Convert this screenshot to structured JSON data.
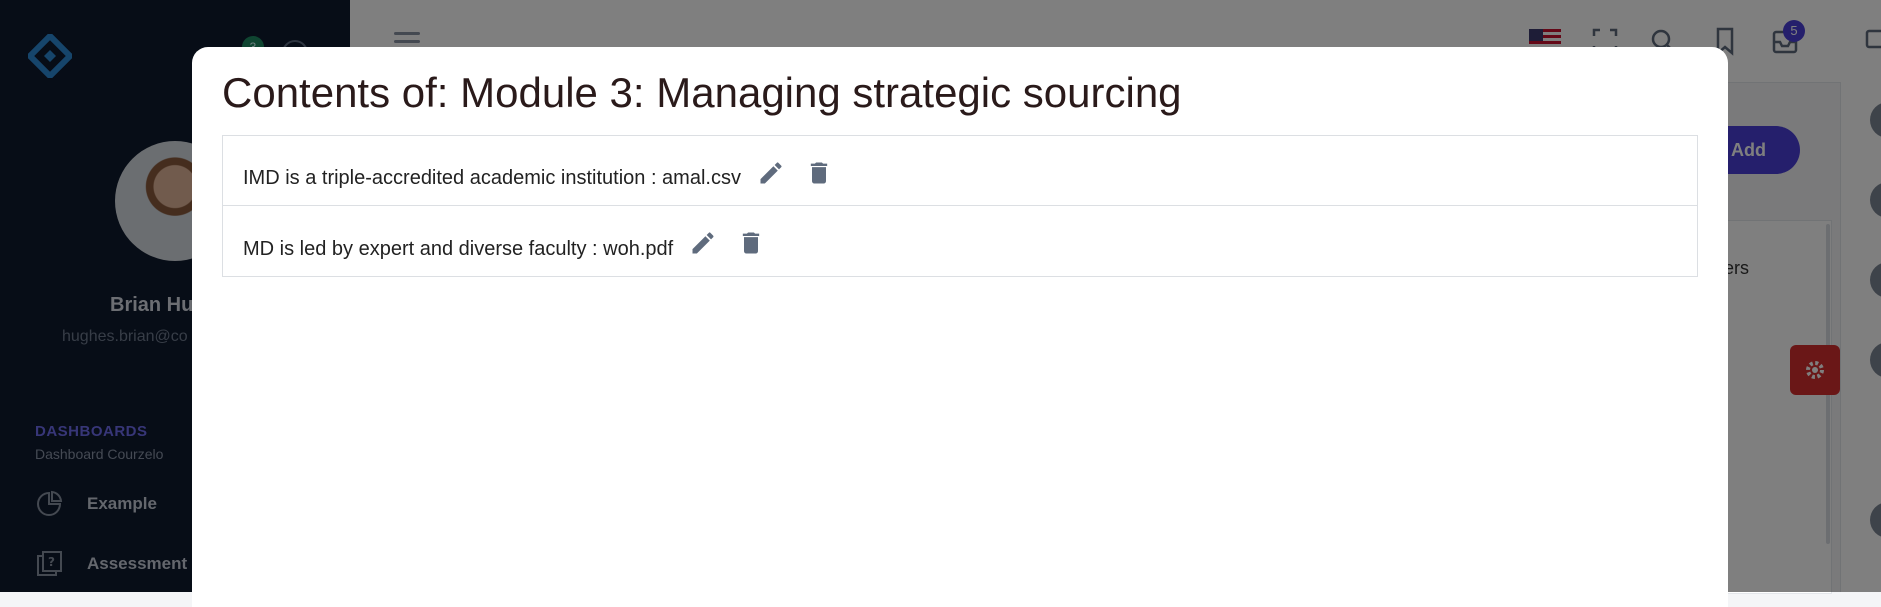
{
  "sidebar": {
    "notification_count": "3",
    "user": {
      "name": "Brian Hu",
      "email": "hughes.brian@co"
    },
    "section_title": "DASHBOARDS",
    "section_subtitle": "Dashboard Courzelo",
    "items": [
      {
        "label": "Example",
        "icon": "pie-chart-icon"
      },
      {
        "label": "Assessment",
        "icon": "question-book-icon"
      }
    ]
  },
  "topbar": {
    "language_flag": "us-flag",
    "mail_badge_count": "5",
    "icons": [
      "hamburger-icon",
      "fullscreen-icon",
      "search-icon",
      "bookmark-icon",
      "mail-icon",
      "chat-icon"
    ]
  },
  "main": {
    "add_button_label": "Add",
    "tab_partial_label": "ers"
  },
  "modal": {
    "title": "Contents of: Module 3: Managing strategic sourcing",
    "items": [
      {
        "text": "IMD is a triple-accredited academic institution : amal.csv"
      },
      {
        "text": "MD is led by expert and diverse faculty : woh.pdf"
      }
    ]
  },
  "colors": {
    "sidebar_bg": "#0f1a2e",
    "accent": "#4b3fd8",
    "danger": "#d42f2f",
    "icon_gray": "#5f6b7d"
  }
}
